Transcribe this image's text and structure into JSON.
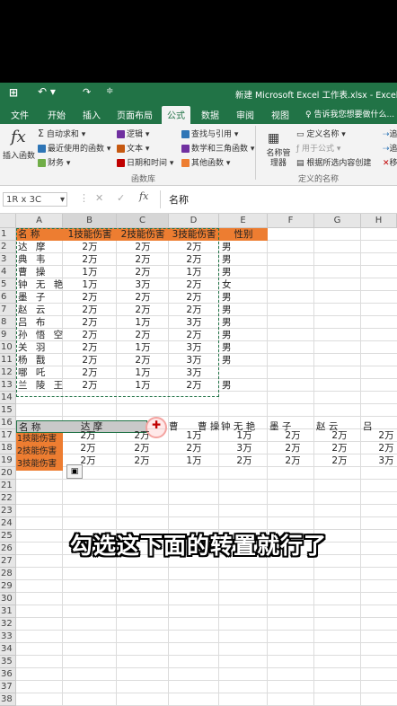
{
  "titlebar": {
    "title": "新建 Microsoft Excel 工作表.xlsx - Excel"
  },
  "tabs": [
    "文件",
    "开始",
    "插入",
    "页面布局",
    "公式",
    "数据",
    "审阅",
    "视图"
  ],
  "active_tab": "公式",
  "tellme": "告诉我您想要做什么...",
  "ribbon": {
    "insert_fn": "插入函数",
    "autosum": "自动求和",
    "recent": "最近使用的函数",
    "finance": "财务",
    "logic": "逻辑",
    "text": "文本",
    "datetime": "日期和时间",
    "lookup": "查找与引用",
    "math": "数学和三角函数",
    "other": "其他函数",
    "group_library": "函数库",
    "name_mgr": "名称管理器",
    "define_name": "定义名称",
    "use_in_formula": "用于公式",
    "create_from_sel": "根据所选内容创建",
    "group_names": "定义的名称",
    "trace1": "追",
    "trace2": "追",
    "remove": "移"
  },
  "namebox": "1R x 3C",
  "formula_value": "名称",
  "columns": [
    "A",
    "B",
    "C",
    "D",
    "E",
    "F",
    "G",
    "H"
  ],
  "rows": [
    "1",
    "2",
    "3",
    "4",
    "5",
    "6",
    "7",
    "8",
    "9",
    "10",
    "11",
    "12",
    "13",
    "14",
    "15",
    "16",
    "17",
    "18",
    "19",
    "20",
    "21",
    "22",
    "23",
    "24",
    "25",
    "26",
    "27",
    "28",
    "29",
    "30",
    "31",
    "32",
    "33",
    "34",
    "35",
    "36",
    "37",
    "38"
  ],
  "header_row": {
    "a": "名 称",
    "b": "1技能伤害",
    "c": "2技能伤害",
    "d": "3技能伤害",
    "e": "性别"
  },
  "table": [
    {
      "a": "达 摩",
      "b": "2万",
      "c": "2万",
      "d": "2万",
      "e": "男"
    },
    {
      "a": "典 韦",
      "b": "2万",
      "c": "2万",
      "d": "2万",
      "e": "男"
    },
    {
      "a": "曹 操",
      "b": "1万",
      "c": "2万",
      "d": "1万",
      "e": "男"
    },
    {
      "a": "钟 无 艳",
      "b": "1万",
      "c": "3万",
      "d": "2万",
      "e": "女"
    },
    {
      "a": "墨 子",
      "b": "2万",
      "c": "2万",
      "d": "2万",
      "e": "男"
    },
    {
      "a": "赵 云",
      "b": "2万",
      "c": "2万",
      "d": "2万",
      "e": "男"
    },
    {
      "a": "吕 布",
      "b": "2万",
      "c": "1万",
      "d": "3万",
      "e": "男"
    },
    {
      "a": "孙 悟 空",
      "b": "2万",
      "c": "2万",
      "d": "2万",
      "e": "男"
    },
    {
      "a": "关 羽",
      "b": "2万",
      "c": "1万",
      "d": "3万",
      "e": "男"
    },
    {
      "a": "杨 戬",
      "b": "2万",
      "c": "2万",
      "d": "3万",
      "e": "男"
    },
    {
      "a": "哪 吒",
      "b": "2万",
      "c": "1万",
      "d": "3万",
      "e": ""
    },
    {
      "a": "兰 陵 王",
      "b": "2万",
      "c": "1万",
      "d": "2万",
      "e": "男"
    }
  ],
  "transposed": {
    "r16": [
      "名 称",
      "达 摩",
      "曹 操",
      "钟 无 艳",
      "墨 子",
      "赵 云",
      "吕"
    ],
    "r16_c": "曹",
    "r17_label": "1技能伤害",
    "r18_label": "2技能伤害",
    "r19_label": "3技能伤害",
    "r17": [
      "2万",
      "2万",
      "1万",
      "1万",
      "2万",
      "2万",
      "2万"
    ],
    "r18": [
      "2万",
      "2万",
      "2万",
      "3万",
      "2万",
      "2万",
      "2万"
    ],
    "r19": [
      "2万",
      "2万",
      "1万",
      "2万",
      "2万",
      "2万",
      "3万"
    ]
  },
  "caption": "勾选这下面的转置就行了",
  "colors": {
    "brand": "#217346",
    "header_fill": "#ed7d31",
    "marquee": "#217346"
  }
}
